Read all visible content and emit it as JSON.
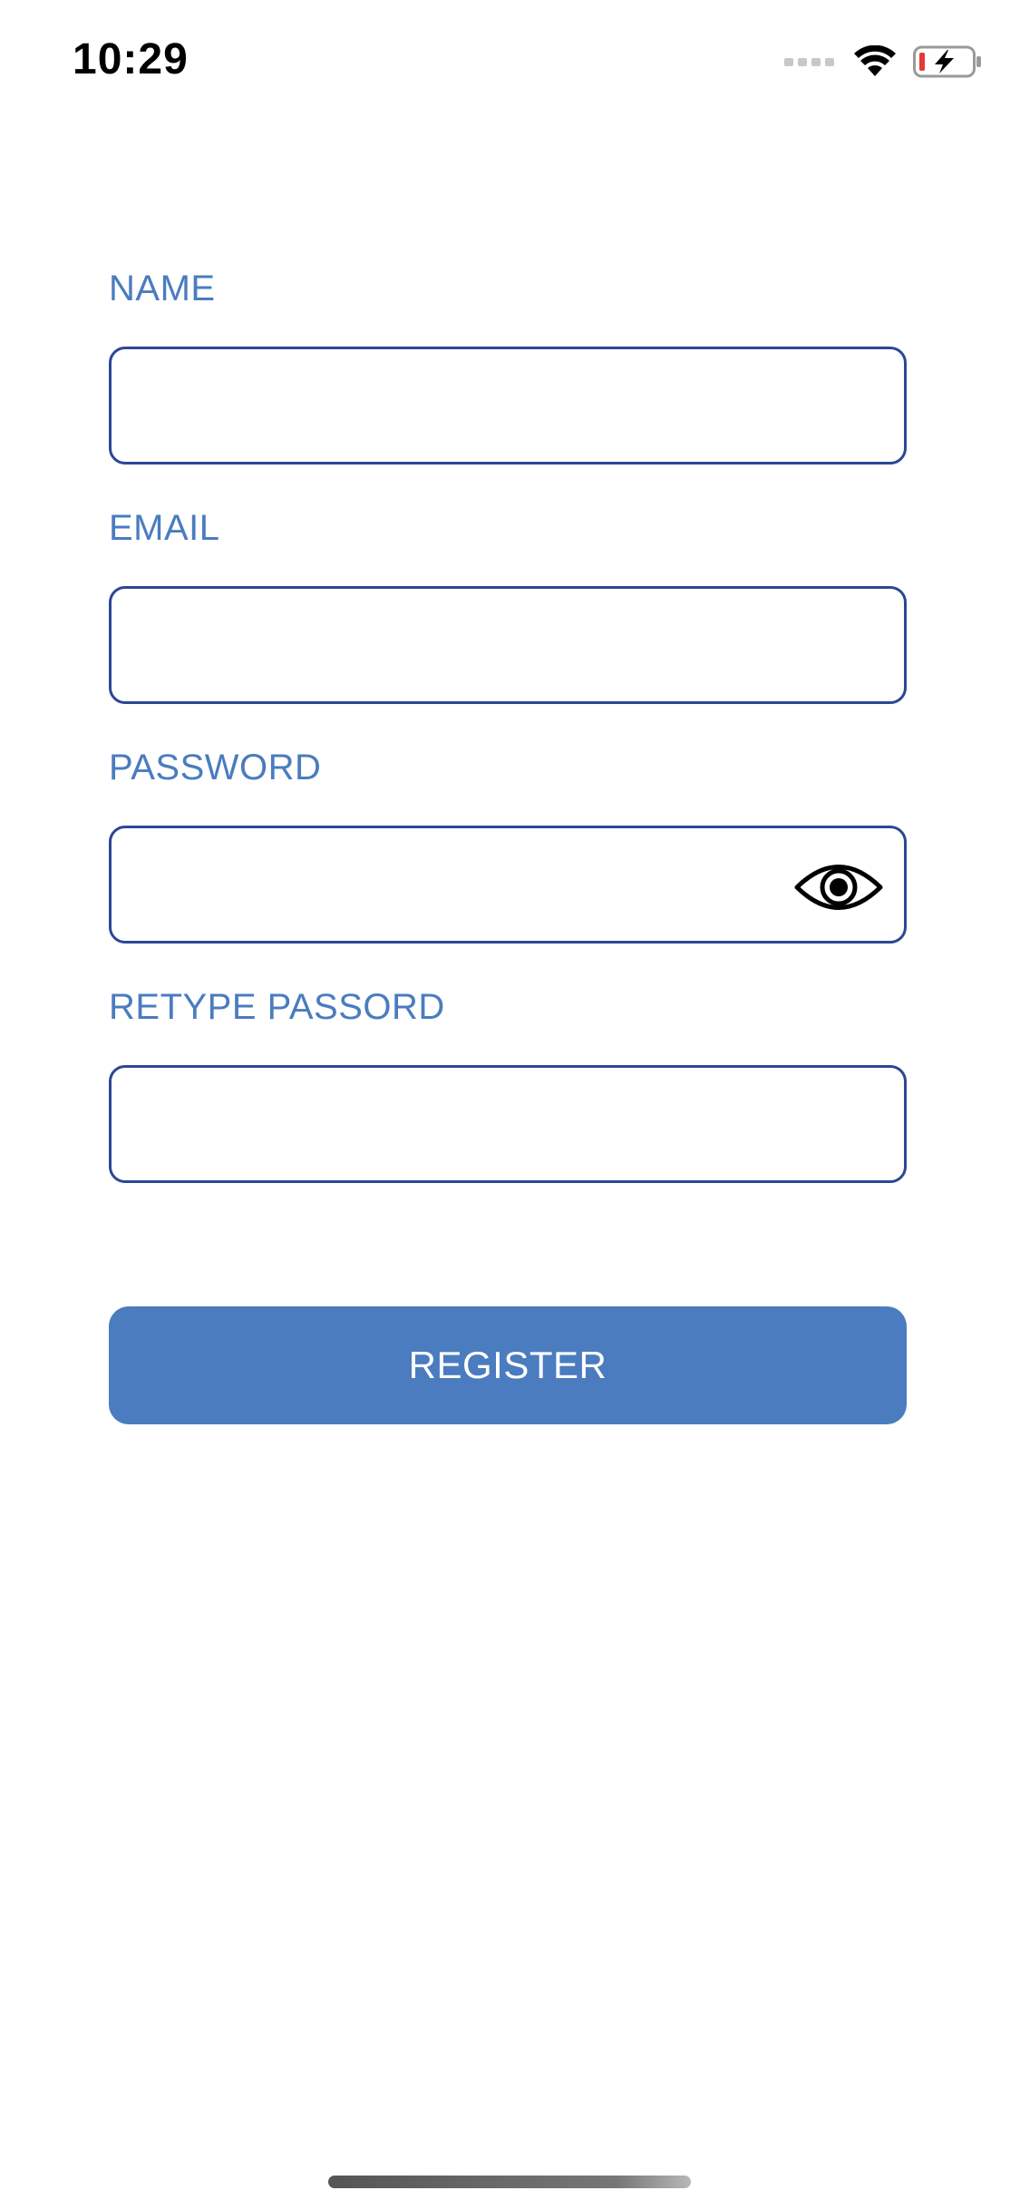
{
  "status_bar": {
    "time": "10:29",
    "icons": [
      "cellular-signal-icon",
      "wifi-icon",
      "battery-charging-icon"
    ],
    "battery_low_color": "#e53935"
  },
  "form": {
    "fields": [
      {
        "label": "NAME",
        "value": "",
        "type": "text"
      },
      {
        "label": "EMAIL",
        "value": "",
        "type": "email"
      },
      {
        "label": "PASSWORD",
        "value": "",
        "type": "password",
        "icon": "eye-icon"
      },
      {
        "label": "RETYPE PASSORD",
        "value": "",
        "type": "password"
      }
    ],
    "submit_label": "REGISTER"
  },
  "colors": {
    "accent": "#4a7cbf",
    "field_border": "#2b4796",
    "background": "#ffffff"
  }
}
